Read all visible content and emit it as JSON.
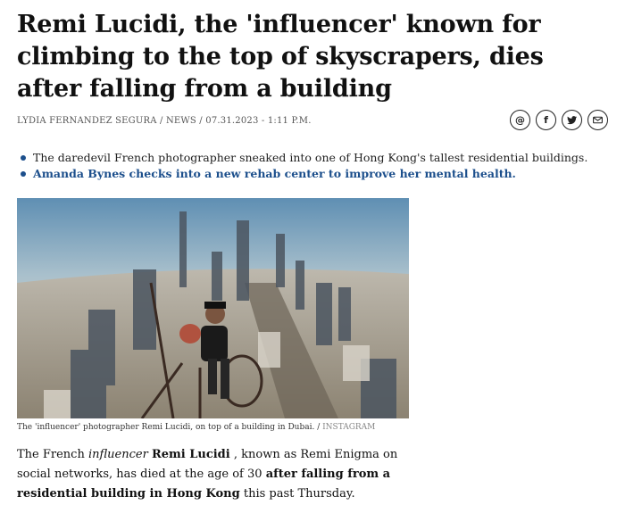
{
  "headline": "Remi Lucidi, the 'influencer' known for climbing to the top of skyscrapers, dies after falling from a building",
  "byline": "LYDIA FERNANDEZ SEGURA / NEWS / 07.31.2023 - 1:11 P.M.",
  "share": {
    "buttons": [
      {
        "name": "threads-icon",
        "glyph": "@"
      },
      {
        "name": "facebook-icon",
        "glyph": "f"
      },
      {
        "name": "twitter-icon",
        "glyph": ""
      },
      {
        "name": "email-icon",
        "glyph": ""
      }
    ]
  },
  "bullets": [
    {
      "text": "The daredevil French photographer sneaked into one of Hong Kong's tallest residential buildings.",
      "is_link": false
    },
    {
      "text": "Amanda Bynes checks into a new rehab center to improve her mental health.",
      "is_link": true
    }
  ],
  "image": {
    "caption": "The 'influencer' photographer Remi Lucidi, on top of a building in Dubai. /",
    "credit": "INSTAGRAM"
  },
  "body": {
    "p1": "The  French",
    "p2": "influencer",
    "p3": "Remi Lucidi",
    "p4": ", known as Remi Enigma on social networks, has died at the age of 30",
    "p5": "after falling from a residential building in Hong Kong",
    "p6": "this past Thursday."
  },
  "colors": {
    "link": "#1c4f8c",
    "text": "#111111"
  }
}
